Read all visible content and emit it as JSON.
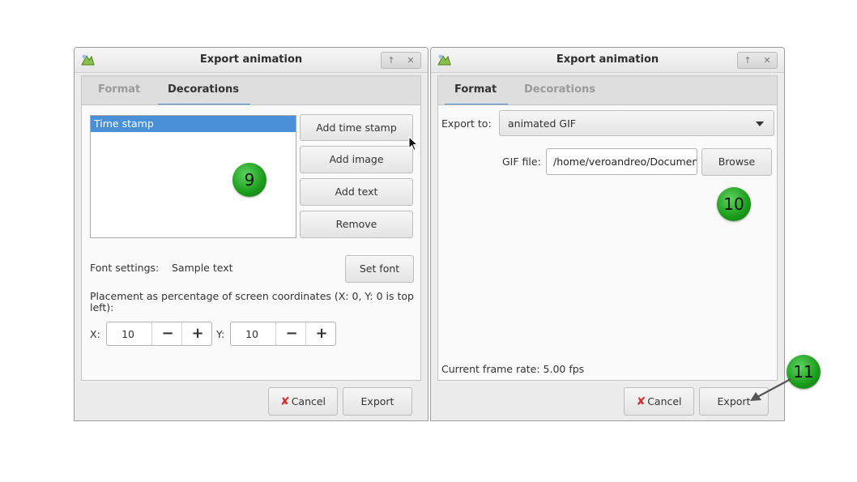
{
  "left_dialog": {
    "title": "Export animation",
    "tabs": [
      {
        "label": "Format"
      },
      {
        "label": "Decorations"
      }
    ],
    "decorations_list": [
      "Time stamp"
    ],
    "buttons": {
      "add_time_stamp": "Add time stamp",
      "add_image": "Add image",
      "add_text": "Add text",
      "remove": "Remove",
      "set_font": "Set font"
    },
    "font_settings_label": "Font settings:",
    "font_sample": "Sample text",
    "placement_label": "Placement as percentage of screen coordinates (X: 0, Y: 0 is top left):",
    "x_label": "X:",
    "x_value": "10",
    "y_label": "Y:",
    "y_value": "10",
    "cancel_label": "Cancel",
    "export_label": "Export"
  },
  "right_dialog": {
    "title": "Export animation",
    "tabs": [
      {
        "label": "Format"
      },
      {
        "label": "Decorations"
      }
    ],
    "export_to_label": "Export to:",
    "export_to_value": "animated GIF",
    "gif_file_label": "GIF file:",
    "gif_file_value": "/home/veroandreo/Documents",
    "browse_label": "Browse",
    "frame_rate": "Current frame rate: 5.00 fps",
    "cancel_label": "Cancel",
    "export_label": "Export"
  },
  "callouts": [
    "9",
    "10",
    "11"
  ],
  "glyphs": {
    "minus": "−",
    "plus": "+",
    "restore": "↑",
    "close": "✕",
    "cancel_x": "✘"
  },
  "colors": {
    "accent": "#4a90d9",
    "badge": "#22a822",
    "cancel_icon": "#d32f2f"
  }
}
